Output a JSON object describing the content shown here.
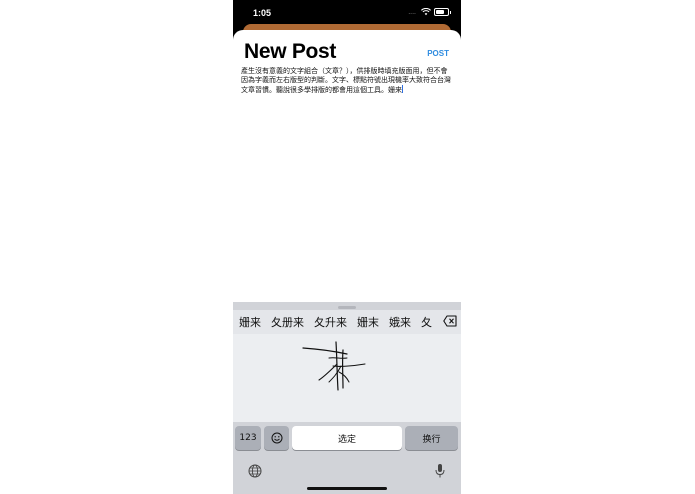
{
  "status_bar": {
    "time": "1:05",
    "signal": "....",
    "icons": [
      "wifi-icon",
      "battery-icon"
    ]
  },
  "post": {
    "title": "New Post",
    "post_label": "POST",
    "body": "產生沒有意義的文字組合（文章？），供排版時填充版面用，但不會因為字義而左右版型的判斷。文字、標點符號出現機率大致符合台灣文章習慣。聽說很多學排版的都會用這個工具。姗来"
  },
  "keyboard": {
    "candidates": [
      "姗来",
      "夂册来",
      "夂升来",
      "姗末",
      "娥来",
      "夂"
    ],
    "numbers_key": "123",
    "emoji_key": "emoji-icon",
    "select_key": "选定",
    "return_key": "换行",
    "globe_key": "globe-icon",
    "mic_key": "microphone-icon"
  },
  "colors": {
    "accent": "#2f8ce0",
    "sheet_back": "#b06a34",
    "keyboard_bg": "#d1d3d8"
  }
}
